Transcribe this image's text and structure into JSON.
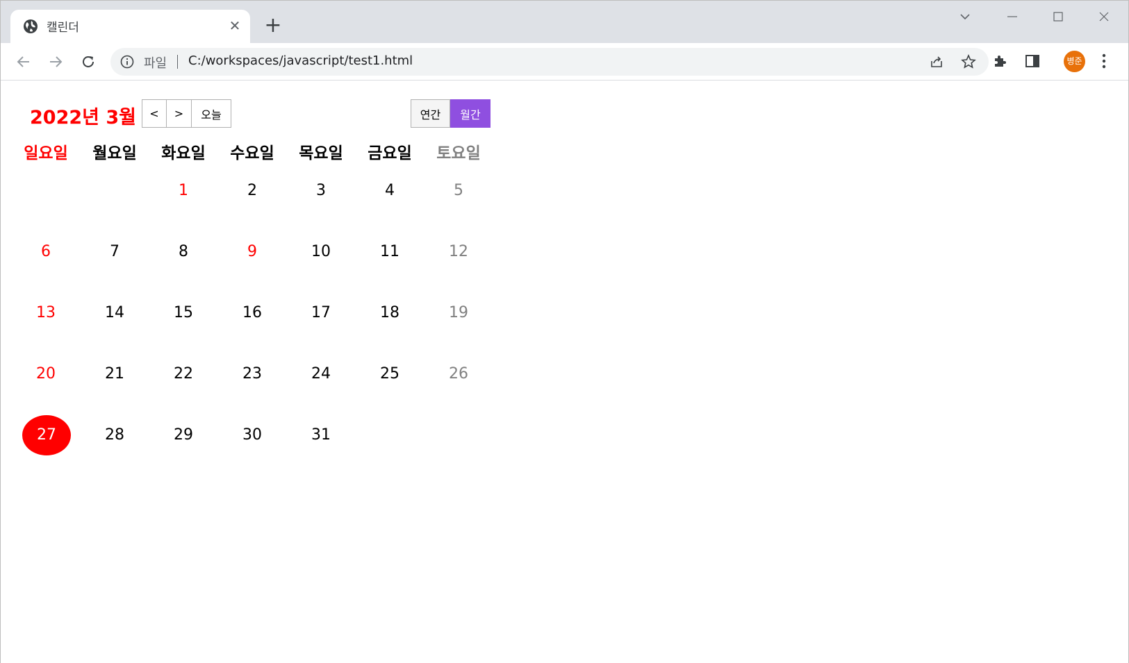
{
  "browser": {
    "tab_title": "캘린더",
    "scheme_label": "파일",
    "url": "C:/workspaces/javascript/test1.html",
    "avatar_label": "병준",
    "avatar_color": "#e8710a"
  },
  "calendar": {
    "title": "2022년 3월",
    "prev_label": "<",
    "next_label": ">",
    "today_label": "오늘",
    "view_yearly_label": "연간",
    "view_monthly_label": "월간",
    "active_view": "월간",
    "accent_color": "#8f4fe0",
    "highlight_color": "#ff0000",
    "weekdays": [
      "일요일",
      "월요일",
      "화요일",
      "수요일",
      "목요일",
      "금요일",
      "토요일"
    ],
    "weeks": [
      [
        "",
        "",
        "1",
        "2",
        "3",
        "4",
        "5"
      ],
      [
        "6",
        "7",
        "8",
        "9",
        "10",
        "11",
        "12"
      ],
      [
        "13",
        "14",
        "15",
        "16",
        "17",
        "18",
        "19"
      ],
      [
        "20",
        "21",
        "22",
        "23",
        "24",
        "25",
        "26"
      ],
      [
        "27",
        "28",
        "29",
        "30",
        "31",
        "",
        ""
      ]
    ],
    "holidays": [
      "1",
      "9"
    ],
    "today": "27"
  }
}
